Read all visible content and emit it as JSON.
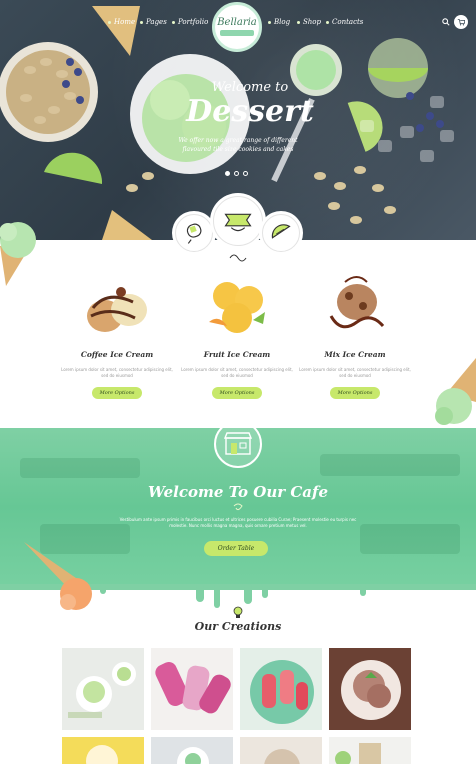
{
  "brand": {
    "name": "Bellaria"
  },
  "nav": {
    "left": [
      {
        "label": "Home"
      },
      {
        "label": "Pages"
      },
      {
        "label": "Portfolio"
      }
    ],
    "right": [
      {
        "label": "Blog"
      },
      {
        "label": "Shop"
      },
      {
        "label": "Contacts"
      }
    ],
    "search_icon": "search-icon",
    "cart_icon": "cart-icon",
    "cart_count": "0"
  },
  "hero": {
    "title_small": "Welcome to",
    "title_large": "Dessert",
    "subtitle": "We offer now a great range of different flavoured tile size cookies and cakes",
    "slides": 3,
    "active_slide": 1
  },
  "features": [
    {
      "icon": "popsicle-icon"
    },
    {
      "icon": "ribbon-banner-icon"
    },
    {
      "icon": "lime-slice-icon"
    }
  ],
  "products": [
    {
      "name": "Coffee Ice Cream",
      "description": "Lorem ipsum dolor sit amet, consectetur adipiscing elit, sed do eiusmod",
      "button": "More Options"
    },
    {
      "name": "Fruit Ice Cream",
      "description": "Lorem ipsum dolor sit amet, consectetur adipiscing elit, sed do eiusmod",
      "button": "More Options"
    },
    {
      "name": "Mix Ice Cream",
      "description": "Lorem ipsum dolor sit amet, consectetur adipiscing elit, sed do eiusmod",
      "button": "More Options"
    }
  ],
  "cafe": {
    "icon": "cafe-storefront-icon",
    "title": "Welcome To Our Cafe",
    "text": "Vestibulum ante ipsum primis in faucibus orci luctus et ultrices posuere cubilia Curae; Praesent molestie eu turpis nec molestie. Nunc mollis magna magna, quis ornare pretium metus vel.",
    "button": "Order Table"
  },
  "creations": {
    "title": "Our Creations",
    "icon": "lightbulb-icon"
  },
  "colors": {
    "mint": "#7fd0a4",
    "lime_button": "#c7e86b",
    "hero_dark": "#3b4a56"
  }
}
